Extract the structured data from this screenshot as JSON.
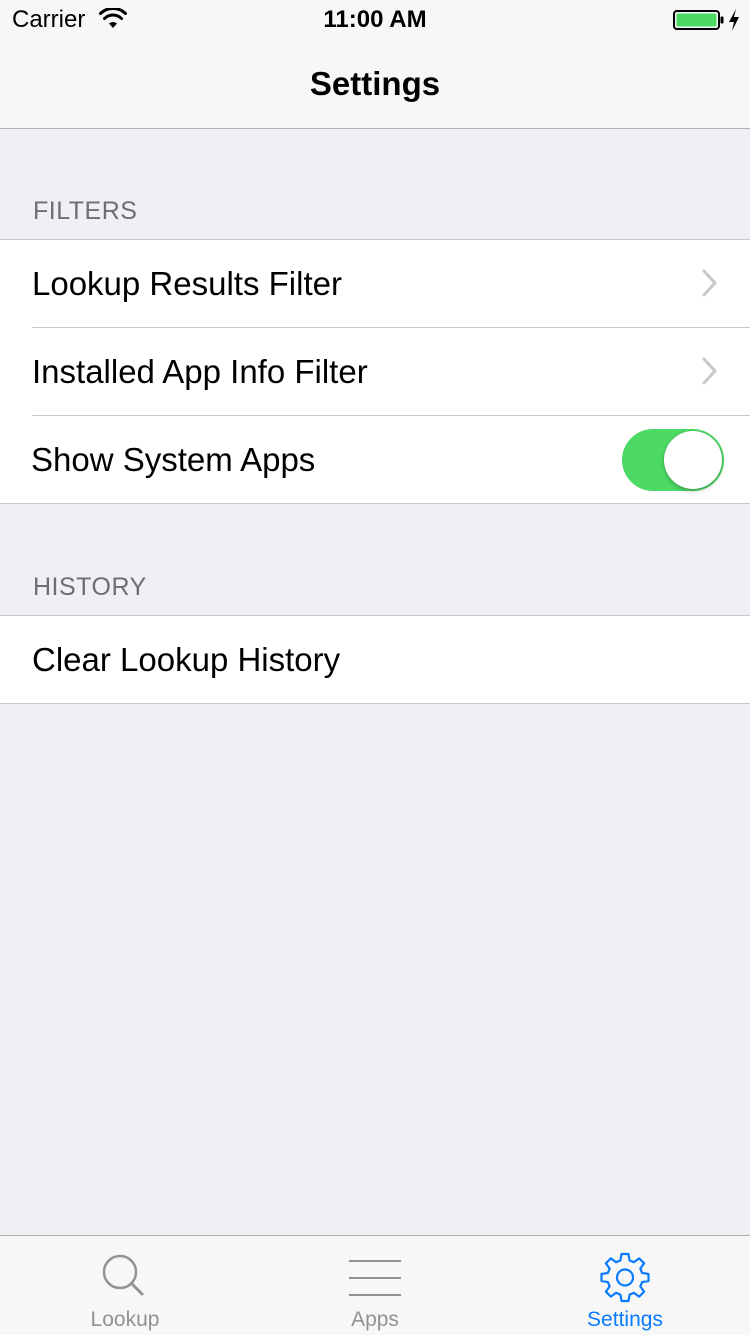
{
  "status_bar": {
    "carrier": "Carrier",
    "time": "11:00 AM"
  },
  "nav": {
    "title": "Settings"
  },
  "sections": {
    "filters": {
      "header": "FILTERS",
      "items": {
        "lookup_results_filter": "Lookup Results Filter",
        "installed_app_info_filter": "Installed App Info Filter",
        "show_system_apps": "Show System Apps"
      },
      "show_system_apps_on": true
    },
    "history": {
      "header": "HISTORY",
      "items": {
        "clear_lookup_history": "Clear Lookup History"
      }
    }
  },
  "tab_bar": {
    "tabs": [
      {
        "label": "Lookup",
        "icon": "search-icon",
        "selected": false
      },
      {
        "label": "Apps",
        "icon": "list-icon",
        "selected": false
      },
      {
        "label": "Settings",
        "icon": "gear-icon",
        "selected": true
      }
    ]
  },
  "colors": {
    "accent": "#0a7aff",
    "toggle_on": "#4cd964",
    "inactive_tab": "#929292",
    "background": "#efeff4"
  }
}
